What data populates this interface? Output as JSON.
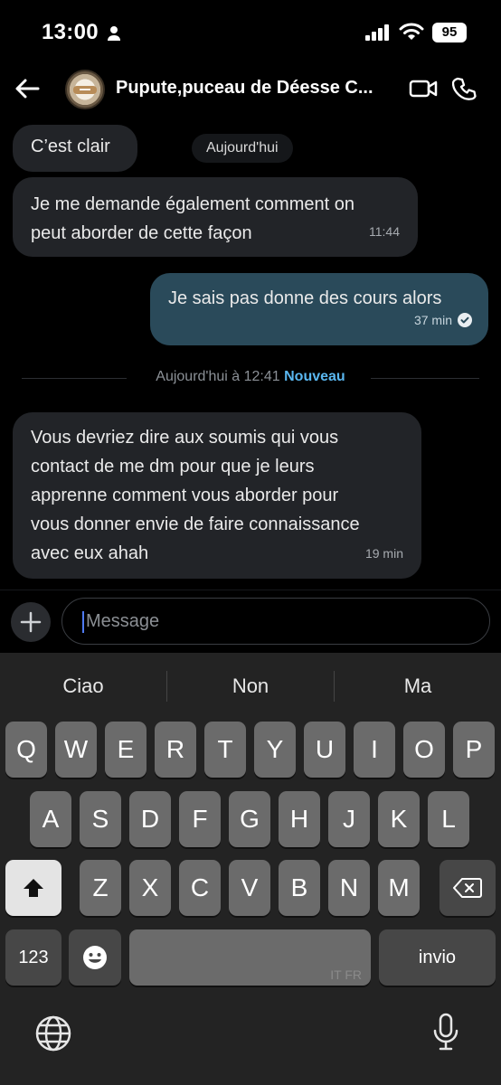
{
  "status": {
    "time": "13:00",
    "battery": "95"
  },
  "header": {
    "title": "Pupute,puceau de Déesse C..."
  },
  "messages": {
    "first_partial": "C’est clair",
    "date_pill": "Aujourd'hui",
    "msg1_lines": [
      "Je me demande également comment on",
      "peut aborder de cette façon"
    ],
    "msg1_time": "11:44",
    "msg2_text": "Je sais pas donne des cours alors",
    "msg2_time": "37 min",
    "divider_text": "Aujourd'hui à 12:41",
    "divider_new": "Nouveau",
    "msg3_lines": [
      "Vous devriez dire aux soumis qui vous",
      "contact de me dm pour que je leurs",
      "apprenne comment vous aborder pour",
      "vous donner envie de faire connaissance",
      "avec eux ahah"
    ],
    "msg3_time": "19 min"
  },
  "composer": {
    "placeholder": "Message"
  },
  "keyboard": {
    "suggestions": [
      "Ciao",
      "Non",
      "Ma"
    ],
    "row1": [
      "Q",
      "W",
      "E",
      "R",
      "T",
      "Y",
      "U",
      "I",
      "O",
      "P"
    ],
    "row2": [
      "A",
      "S",
      "D",
      "F",
      "G",
      "H",
      "J",
      "K",
      "L"
    ],
    "row3": [
      "Z",
      "X",
      "C",
      "V",
      "B",
      "N",
      "M"
    ],
    "num_label": "123",
    "space_label": "IT FR",
    "return_label": "invio"
  },
  "colors": {
    "accent": "#5ab7f0",
    "sent_bubble": "#2a4a5a",
    "recv_bubble": "#222428"
  },
  "icons": [
    "person-icon",
    "signal-icon",
    "wifi-icon",
    "back-arrow-icon",
    "video-call-icon",
    "phone-icon",
    "plus-icon",
    "check-icon",
    "shift-icon",
    "backspace-icon",
    "emoji-icon",
    "globe-icon",
    "microphone-icon"
  ]
}
